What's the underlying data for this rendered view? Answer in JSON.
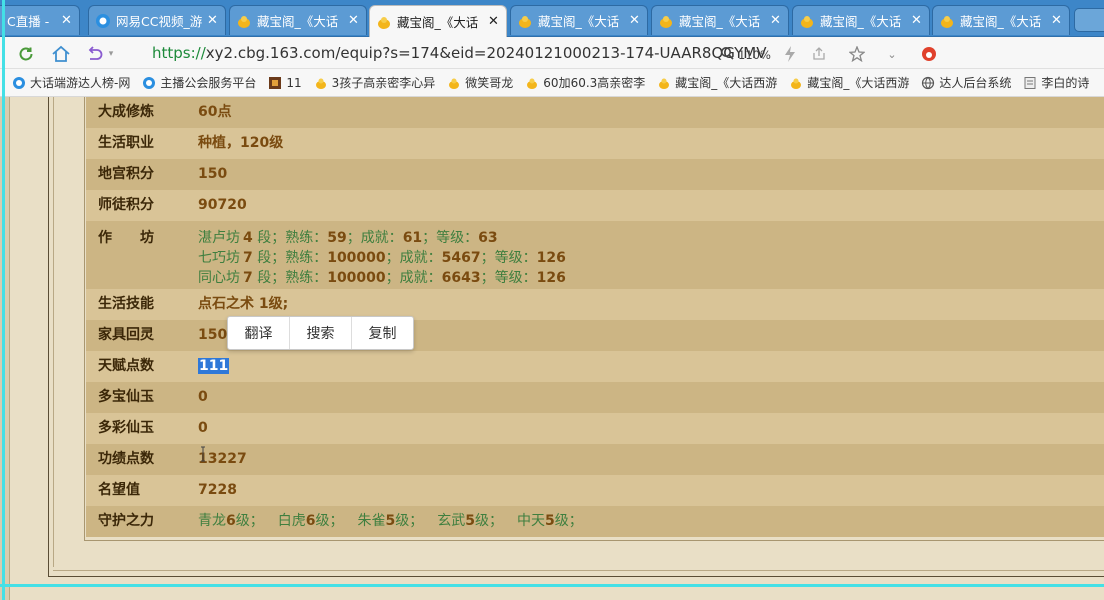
{
  "tabs": [
    {
      "title": "C直播 - ",
      "icon": "cc-icon",
      "active": false
    },
    {
      "title": "网易CC视频_游",
      "icon": "cc-icon",
      "active": false
    },
    {
      "title": "藏宝阁_《大话",
      "icon": "cbg-icon",
      "active": false
    },
    {
      "title": "藏宝阁_《大话",
      "icon": "cbg-icon",
      "active": true
    },
    {
      "title": "藏宝阁_《大话",
      "icon": "cbg-icon",
      "active": false
    },
    {
      "title": "藏宝阁_《大话",
      "icon": "cbg-icon",
      "active": false
    },
    {
      "title": "藏宝阁_《大话",
      "icon": "cbg-icon",
      "active": false
    },
    {
      "title": "藏宝阁_《大话",
      "icon": "cbg-icon",
      "active": false
    }
  ],
  "address": {
    "scheme": "https://",
    "rest": "xy2.cbg.163.com/equip?s=174&eid=20240121000213-174-UAAR8QGYMV",
    "zoom": "110%",
    "news": ""
  },
  "bookmarks": [
    {
      "label": "大话端游达人榜-网",
      "icon": "cc-icon"
    },
    {
      "label": "主播公会服务平台",
      "icon": "cc-icon"
    },
    {
      "label": "11",
      "icon": "game-icon"
    },
    {
      "label": "3孩子高亲密李心异",
      "icon": "cbg-icon"
    },
    {
      "label": "微笑哥龙",
      "icon": "cbg-icon"
    },
    {
      "label": "60加60.3高亲密李",
      "icon": "cbg-icon"
    },
    {
      "label": "藏宝阁_《大话西游",
      "icon": "cbg-icon"
    },
    {
      "label": "藏宝阁_《大话西游",
      "icon": "cbg-icon"
    },
    {
      "label": "达人后台系统",
      "icon": "globe-icon"
    },
    {
      "label": "李白的诗",
      "icon": "book-icon"
    }
  ],
  "rows": {
    "dacheng": {
      "label": "大成修炼",
      "value": "60点"
    },
    "shenghuo": {
      "label": "生活职业",
      "value": "种植，120级"
    },
    "digong": {
      "label": "地宫积分",
      "value": "150"
    },
    "shitu": {
      "label": "师徒积分",
      "value": "90720"
    },
    "zuofang": {
      "label": "作　　坊",
      "lines": [
        {
          "name": "湛卢坊",
          "duan": "4",
          "shulian": "59",
          "chengjiu": "61",
          "dengji": "63"
        },
        {
          "name": "七巧坊",
          "duan": "7",
          "shulian": "100000",
          "chengjiu": "5467",
          "dengji": "126"
        },
        {
          "name": "同心坊",
          "duan": "7",
          "shulian": "100000",
          "chengjiu": "6643",
          "dengji": "126"
        }
      ],
      "duan_suffix": " 段；",
      "shulian_label": "熟练：",
      "chengjiu_label": "成就：",
      "dengji_label": "等级："
    },
    "jineng": {
      "label": "生活技能",
      "value": "点石之术 1级;"
    },
    "jiaju": {
      "label": "家具回灵",
      "value": "150"
    },
    "tianfu": {
      "label": "天赋点数",
      "value": "111"
    },
    "duobao": {
      "label": "多宝仙玉",
      "value": "0"
    },
    "duocai": {
      "label": "多彩仙玉",
      "value": "0"
    },
    "gongji": {
      "label": "功绩点数",
      "value": "13227"
    },
    "mingwang": {
      "label": "名望值",
      "value": "7228"
    },
    "shouhu": {
      "label": "守护之力",
      "items": [
        {
          "name": "青龙",
          "level": "6"
        },
        {
          "name": "白虎",
          "level": "6"
        },
        {
          "name": "朱雀",
          "level": "5"
        },
        {
          "name": "玄武",
          "level": "5"
        },
        {
          "name": "中天",
          "level": "5"
        }
      ],
      "level_suffix": "级；"
    }
  },
  "popup": {
    "translate": "翻译",
    "search": "搜索",
    "copy": "复制"
  },
  "colors": {
    "tab_strip": "#3d86c8",
    "row_odd": "#ccb584",
    "row_even": "#d9c497",
    "value_text": "#7a4b10",
    "green_text": "#3f7f3f",
    "selection": "#2f78d8",
    "frame_cyan": "#44e0e6"
  }
}
